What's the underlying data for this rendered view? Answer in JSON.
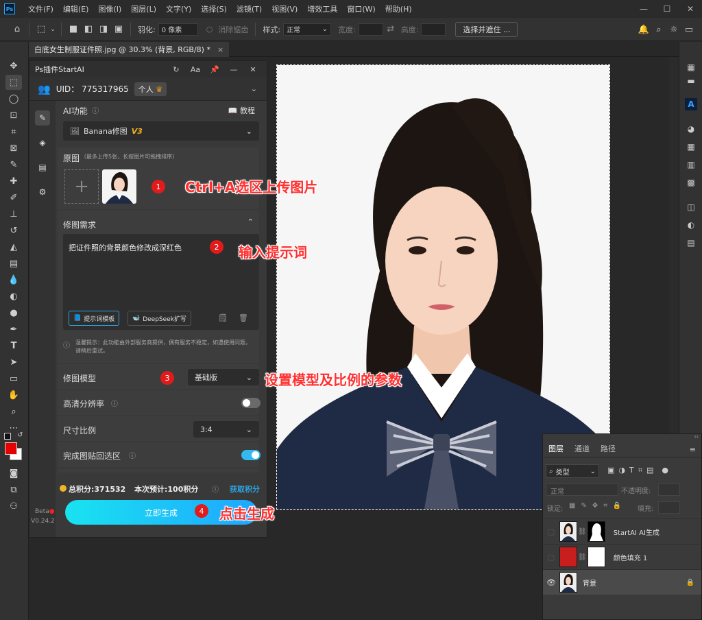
{
  "app": {
    "logo": "Ps"
  },
  "menu": [
    "文件(F)",
    "编辑(E)",
    "图像(I)",
    "图层(L)",
    "文字(Y)",
    "选择(S)",
    "滤镜(T)",
    "视图(V)",
    "增效工具",
    "窗口(W)",
    "帮助(H)"
  ],
  "options": {
    "feather_label": "羽化:",
    "feather_value": "0 像素",
    "antialias_label": "消除锯齿",
    "style_label": "样式:",
    "style_value": "正常",
    "width_label": "宽度:",
    "height_label": "高度:",
    "select_mask_button": "选择并遮住 ..."
  },
  "document_tab": {
    "title": "白底女生制服证件照.jpg @ 30.3% (背景, RGB/8) *",
    "close": "×"
  },
  "plugin": {
    "title": "Ps插件StartAI",
    "header_aa": "Aa",
    "uid": "UID： 775317965",
    "account_type": "个人",
    "ai_function_label": "AI功能",
    "tutorial_label": "教程",
    "function_value": "Banana修图",
    "function_version": "V3",
    "source_label": "原图",
    "source_hint": "（最多上传5张，长按图片可拖拽排序）",
    "requirement_label": "修图需求",
    "prompt_text": "把证件照的背景颜色修改成深红色",
    "prompt_template_button": "提示词模板",
    "deepseek_button": "DeepSeek扩写",
    "notice": "温馨提示：此功能由外部服务商提供，偶有服务不稳定，如遇使用问题，请稍后重试。",
    "model_label": "修图模型",
    "model_value": "基础版",
    "hd_label": "高清分辨率",
    "hd_enabled": false,
    "ratio_label": "尺寸比例",
    "ratio_value": "3:4",
    "paste_back_label": "完成图贴回选区",
    "paste_back_enabled": true,
    "total_points": "总积分:371532",
    "estimate": "本次预计:100积分",
    "get_points": "获取积分",
    "generate_button": "立即生成",
    "beta_label": "Beta",
    "version": "V0.24.2",
    "accent_color": "#1fb6ff",
    "toggle_on_color": "#33b8f0"
  },
  "annotations": [
    {
      "num": "1",
      "text": "Ctrl+A选区上传图片"
    },
    {
      "num": "2",
      "text": "输入提示词"
    },
    {
      "num": "3",
      "text": "设置模型及比例的参数"
    },
    {
      "num": "4",
      "text": "点击生成"
    }
  ],
  "layers": {
    "tabs": [
      "图层",
      "通道",
      "路径"
    ],
    "filter_label": "类型",
    "blend_mode": "正常",
    "opacity_label": "不透明度:",
    "lock_label": "锁定:",
    "fill_label": "填充:",
    "items": [
      {
        "name": "StartAI AI生成",
        "visible": false,
        "locked": false
      },
      {
        "name": "颜色填充 1",
        "visible": false,
        "locked": false
      },
      {
        "name": "背景",
        "visible": true,
        "locked": true
      }
    ]
  }
}
